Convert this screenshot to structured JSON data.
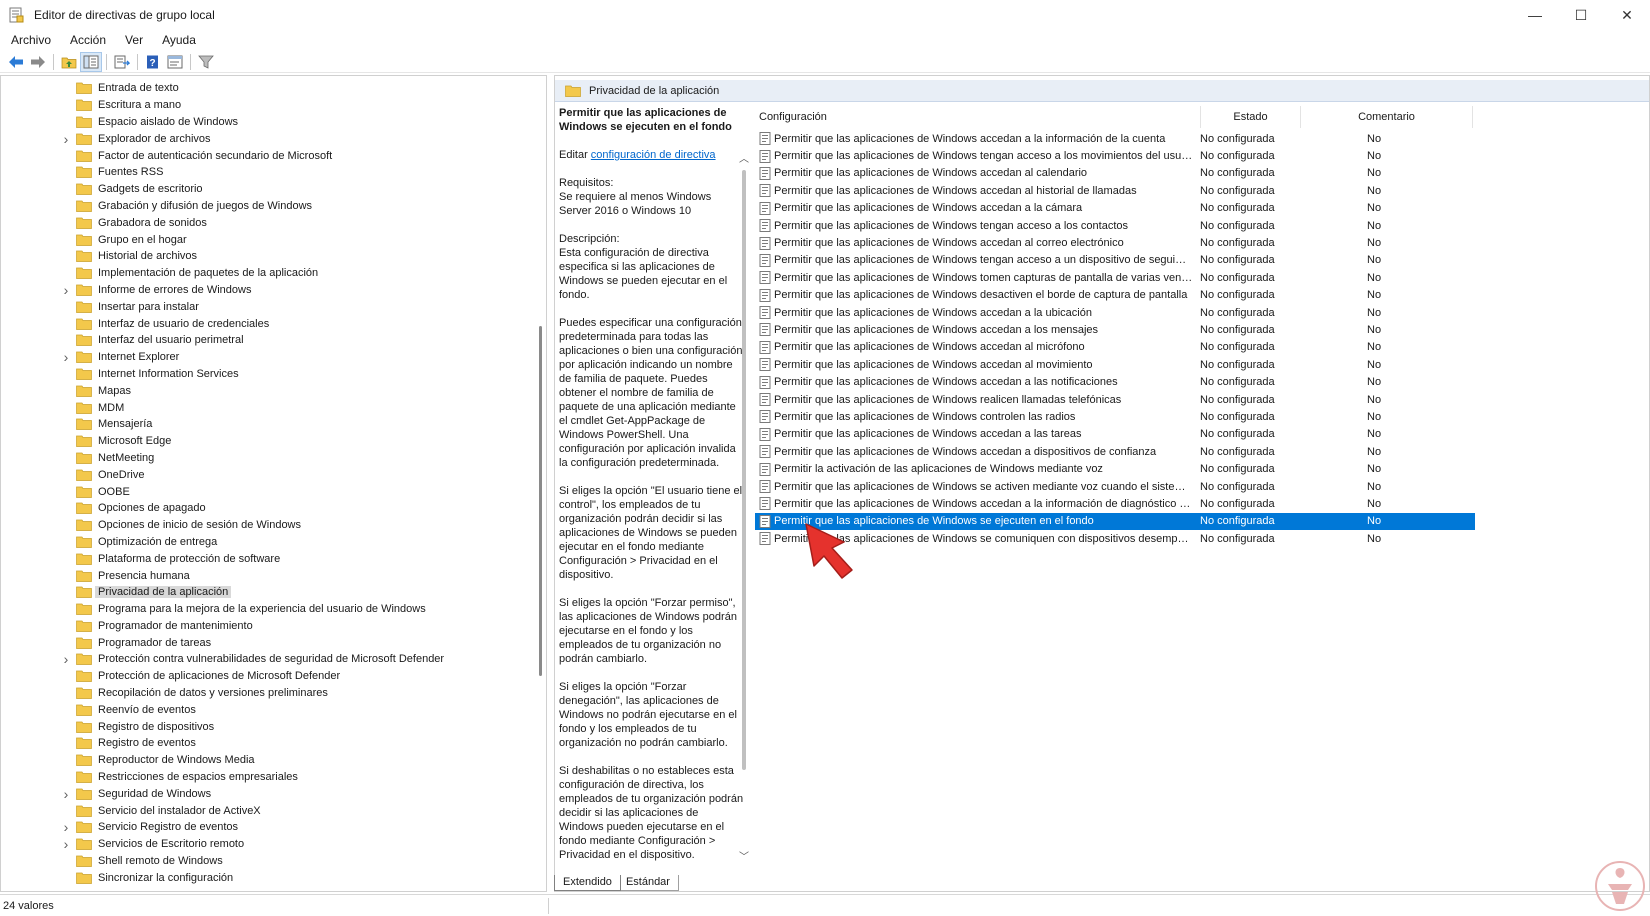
{
  "window": {
    "title": "Editor de directivas de grupo local",
    "controls": {
      "minimize": "—",
      "maximize": "☐",
      "close": "✕"
    }
  },
  "menu": {
    "items": [
      "Archivo",
      "Acción",
      "Ver",
      "Ayuda"
    ]
  },
  "toolbar": {
    "icons": [
      "back-arrow-icon",
      "forward-arrow-icon",
      "up-folder-icon",
      "show-hide-tree-icon",
      "export-list-icon",
      "help-icon",
      "properties-icon",
      "filter-icon"
    ]
  },
  "tree": {
    "items": [
      {
        "label": "Entrada de texto",
        "expandable": false,
        "selected": false
      },
      {
        "label": "Escritura a mano",
        "expandable": false,
        "selected": false
      },
      {
        "label": "Espacio aislado de Windows",
        "expandable": false,
        "selected": false
      },
      {
        "label": "Explorador de archivos",
        "expandable": true,
        "selected": false
      },
      {
        "label": "Factor de autenticación secundario de Microsoft",
        "expandable": false,
        "selected": false
      },
      {
        "label": "Fuentes RSS",
        "expandable": false,
        "selected": false
      },
      {
        "label": "Gadgets de escritorio",
        "expandable": false,
        "selected": false
      },
      {
        "label": "Grabación y difusión de juegos de Windows",
        "expandable": false,
        "selected": false
      },
      {
        "label": "Grabadora de sonidos",
        "expandable": false,
        "selected": false
      },
      {
        "label": "Grupo en el hogar",
        "expandable": false,
        "selected": false
      },
      {
        "label": "Historial de archivos",
        "expandable": false,
        "selected": false
      },
      {
        "label": "Implementación de paquetes de la aplicación",
        "expandable": false,
        "selected": false
      },
      {
        "label": "Informe de errores de Windows",
        "expandable": true,
        "selected": false
      },
      {
        "label": "Insertar para instalar",
        "expandable": false,
        "selected": false
      },
      {
        "label": "Interfaz de usuario de credenciales",
        "expandable": false,
        "selected": false
      },
      {
        "label": "Interfaz del usuario perimetral",
        "expandable": false,
        "selected": false
      },
      {
        "label": "Internet Explorer",
        "expandable": true,
        "selected": false
      },
      {
        "label": "Internet Information Services",
        "expandable": false,
        "selected": false
      },
      {
        "label": "Mapas",
        "expandable": false,
        "selected": false
      },
      {
        "label": "MDM",
        "expandable": false,
        "selected": false
      },
      {
        "label": "Mensajería",
        "expandable": false,
        "selected": false
      },
      {
        "label": "Microsoft Edge",
        "expandable": false,
        "selected": false
      },
      {
        "label": "NetMeeting",
        "expandable": false,
        "selected": false
      },
      {
        "label": "OneDrive",
        "expandable": false,
        "selected": false
      },
      {
        "label": "OOBE",
        "expandable": false,
        "selected": false
      },
      {
        "label": "Opciones de apagado",
        "expandable": false,
        "selected": false
      },
      {
        "label": "Opciones de inicio de sesión de Windows",
        "expandable": false,
        "selected": false
      },
      {
        "label": "Optimización de entrega",
        "expandable": false,
        "selected": false
      },
      {
        "label": "Plataforma de protección de software",
        "expandable": false,
        "selected": false
      },
      {
        "label": "Presencia humana",
        "expandable": false,
        "selected": false
      },
      {
        "label": "Privacidad de la aplicación",
        "expandable": false,
        "selected": true
      },
      {
        "label": "Programa para la mejora de la experiencia del usuario de Windows",
        "expandable": false,
        "selected": false
      },
      {
        "label": "Programador de mantenimiento",
        "expandable": false,
        "selected": false
      },
      {
        "label": "Programador de tareas",
        "expandable": false,
        "selected": false
      },
      {
        "label": "Protección contra vulnerabilidades de seguridad de Microsoft Defender",
        "expandable": true,
        "selected": false
      },
      {
        "label": "Protección de aplicaciones de Microsoft Defender",
        "expandable": false,
        "selected": false
      },
      {
        "label": "Recopilación de datos y versiones preliminares",
        "expandable": false,
        "selected": false
      },
      {
        "label": "Reenvío de eventos",
        "expandable": false,
        "selected": false
      },
      {
        "label": "Registro de dispositivos",
        "expandable": false,
        "selected": false
      },
      {
        "label": "Registro de eventos",
        "expandable": false,
        "selected": false
      },
      {
        "label": "Reproductor de Windows Media",
        "expandable": false,
        "selected": false
      },
      {
        "label": "Restricciones de espacios empresariales",
        "expandable": false,
        "selected": false
      },
      {
        "label": "Seguridad de Windows",
        "expandable": true,
        "selected": false
      },
      {
        "label": "Servicio del instalador de ActiveX",
        "expandable": false,
        "selected": false
      },
      {
        "label": "Servicio Registro de eventos",
        "expandable": true,
        "selected": false
      },
      {
        "label": "Servicios de Escritorio remoto",
        "expandable": true,
        "selected": false
      },
      {
        "label": "Shell remoto de Windows",
        "expandable": false,
        "selected": false
      },
      {
        "label": "Sincronizar la configuración",
        "expandable": false,
        "selected": false
      }
    ]
  },
  "detail": {
    "header": "Privacidad de la aplicación",
    "description": {
      "title": "Permitir que las aplicaciones de Windows se ejecuten en el fondo",
      "edit_prefix": "Editar ",
      "edit_link": "configuración de directiva",
      "requirements_label": "Requisitos:",
      "requirements_text": "Se requiere al menos Windows Server 2016 o Windows 10",
      "description_label": "Descripción:",
      "description_text": "Esta configuración de directiva especifica si las aplicaciones de Windows se pueden ejecutar en el fondo.",
      "para1": "Puedes especificar una configuración predeterminada para todas las aplicaciones o bien una configuración por aplicación indicando un nombre de familia de paquete. Puedes obtener el nombre de familia de paquete de una aplicación mediante el cmdlet Get-AppPackage de Windows PowerShell. Una configuración por aplicación invalida la configuración predeterminada.",
      "para2": "Si eliges la opción \"El usuario tiene el control\", los empleados de tu organización podrán decidir si las aplicaciones de Windows se pueden ejecutar en el fondo mediante Configuración > Privacidad en el dispositivo.",
      "para3": "Si eliges la opción \"Forzar permiso\", las aplicaciones de Windows podrán ejecutarse en el fondo y los empleados de tu organización no podrán cambiarlo.",
      "para4": "Si eliges la opción \"Forzar denegación\", las aplicaciones de Windows no podrán ejecutarse en el fondo y los empleados de tu organización no podrán cambiarlo.",
      "para5": "Si deshabilitas o no estableces esta configuración de directiva, los empleados de tu organización podrán decidir si las aplicaciones de Windows pueden ejecutarse en el fondo mediante Configuración > Privacidad en el dispositivo."
    },
    "columns": {
      "config": "Configuración",
      "state": "Estado",
      "comment": "Comentario"
    },
    "rows": [
      {
        "name": "Permitir que las aplicaciones de Windows accedan a la información de la cuenta",
        "state": "No configurada",
        "comment": "No",
        "selected": false
      },
      {
        "name": "Permitir que las aplicaciones de Windows tengan acceso a los movimientos del usuario ...",
        "state": "No configurada",
        "comment": "No",
        "selected": false
      },
      {
        "name": "Permitir que las aplicaciones de Windows accedan al calendario",
        "state": "No configurada",
        "comment": "No",
        "selected": false
      },
      {
        "name": "Permitir que las aplicaciones de Windows accedan al historial de llamadas",
        "state": "No configurada",
        "comment": "No",
        "selected": false
      },
      {
        "name": "Permitir que las aplicaciones de Windows accedan a la cámara",
        "state": "No configurada",
        "comment": "No",
        "selected": false
      },
      {
        "name": "Permitir que las aplicaciones de Windows tengan acceso a los contactos",
        "state": "No configurada",
        "comment": "No",
        "selected": false
      },
      {
        "name": "Permitir que las aplicaciones de Windows accedan al correo electrónico",
        "state": "No configurada",
        "comment": "No",
        "selected": false
      },
      {
        "name": "Permitir que las aplicaciones de Windows tengan acceso a un dispositivo de seguimient...",
        "state": "No configurada",
        "comment": "No",
        "selected": false
      },
      {
        "name": "Permitir que las aplicaciones de Windows tomen capturas de pantalla de varias ventana...",
        "state": "No configurada",
        "comment": "No",
        "selected": false
      },
      {
        "name": "Permitir que las aplicaciones de Windows desactiven el borde de captura de pantalla",
        "state": "No configurada",
        "comment": "No",
        "selected": false
      },
      {
        "name": "Permitir que las aplicaciones de Windows accedan a la ubicación",
        "state": "No configurada",
        "comment": "No",
        "selected": false
      },
      {
        "name": "Permitir que las aplicaciones de Windows accedan a los mensajes",
        "state": "No configurada",
        "comment": "No",
        "selected": false
      },
      {
        "name": "Permitir que las aplicaciones de Windows accedan al micrófono",
        "state": "No configurada",
        "comment": "No",
        "selected": false
      },
      {
        "name": "Permitir que las aplicaciones de Windows accedan al movimiento",
        "state": "No configurada",
        "comment": "No",
        "selected": false
      },
      {
        "name": "Permitir que las aplicaciones de Windows accedan a las notificaciones",
        "state": "No configurada",
        "comment": "No",
        "selected": false
      },
      {
        "name": "Permitir que las aplicaciones de Windows realicen llamadas telefónicas",
        "state": "No configurada",
        "comment": "No",
        "selected": false
      },
      {
        "name": "Permitir que las aplicaciones de Windows controlen las radios",
        "state": "No configurada",
        "comment": "No",
        "selected": false
      },
      {
        "name": "Permitir que las aplicaciones de Windows accedan a las tareas",
        "state": "No configurada",
        "comment": "No",
        "selected": false
      },
      {
        "name": "Permitir que las aplicaciones de Windows accedan a dispositivos de confianza",
        "state": "No configurada",
        "comment": "No",
        "selected": false
      },
      {
        "name": "Permitir la activación de las aplicaciones de Windows mediante voz",
        "state": "No configurada",
        "comment": "No",
        "selected": false
      },
      {
        "name": "Permitir que las aplicaciones de Windows se activen mediante voz cuando el sistema es...",
        "state": "No configurada",
        "comment": "No",
        "selected": false
      },
      {
        "name": "Permitir que las aplicaciones de Windows accedan a la información de diagnóstico sobr...",
        "state": "No configurada",
        "comment": "No",
        "selected": false
      },
      {
        "name": "Permitir que las aplicaciones de Windows se ejecuten en el fondo",
        "state": "No configurada",
        "comment": "No",
        "selected": true
      },
      {
        "name": "Permitir que las aplicaciones de Windows se comuniquen con dispositivos desempareja...",
        "state": "No configurada",
        "comment": "No",
        "selected": false
      }
    ]
  },
  "tabs": {
    "extended": "Extendido",
    "standard": "Estándar"
  },
  "status": {
    "text": "24 valores"
  },
  "colors": {
    "selection": "#0078d7",
    "header_bg": "#e8eef6",
    "link": "#0066cc",
    "folder": "#f3c84b",
    "pointer": "#e5322d"
  }
}
